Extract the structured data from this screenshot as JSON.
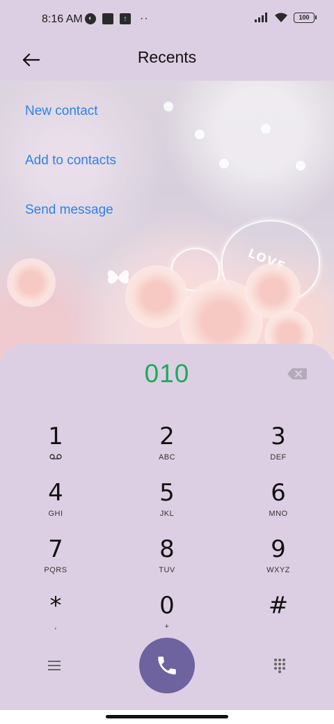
{
  "status_bar": {
    "time": "8:16 AM",
    "battery": "100",
    "icons_left": [
      "notification-circle-icon",
      "square-app-icon",
      "upload-icon",
      "more-dots-icon"
    ],
    "icons_right": [
      "signal-icon",
      "wifi-icon",
      "battery-icon"
    ]
  },
  "app_bar": {
    "title": "Recents",
    "back_icon": "arrow-left-icon"
  },
  "actions": [
    {
      "label": "New contact"
    },
    {
      "label": "Add to contacts"
    },
    {
      "label": "Send message"
    }
  ],
  "wallpaper": {
    "text": "LOVE"
  },
  "dialpad": {
    "number": "010",
    "keys": [
      {
        "digit": "1",
        "letters": ""
      },
      {
        "digit": "2",
        "letters": "ABC"
      },
      {
        "digit": "3",
        "letters": "DEF"
      },
      {
        "digit": "4",
        "letters": "GHI"
      },
      {
        "digit": "5",
        "letters": "JKL"
      },
      {
        "digit": "6",
        "letters": "MNO"
      },
      {
        "digit": "7",
        "letters": "PQRS"
      },
      {
        "digit": "8",
        "letters": "TUV"
      },
      {
        "digit": "9",
        "letters": "WXYZ"
      },
      {
        "digit": "*",
        "letters": ","
      },
      {
        "digit": "0",
        "letters": "+"
      },
      {
        "digit": "#",
        "letters": ""
      }
    ]
  },
  "colors": {
    "background": "#ddcfe3",
    "link": "#2f80e6",
    "number": "#1caa5a",
    "call_button": "#6e629f"
  }
}
